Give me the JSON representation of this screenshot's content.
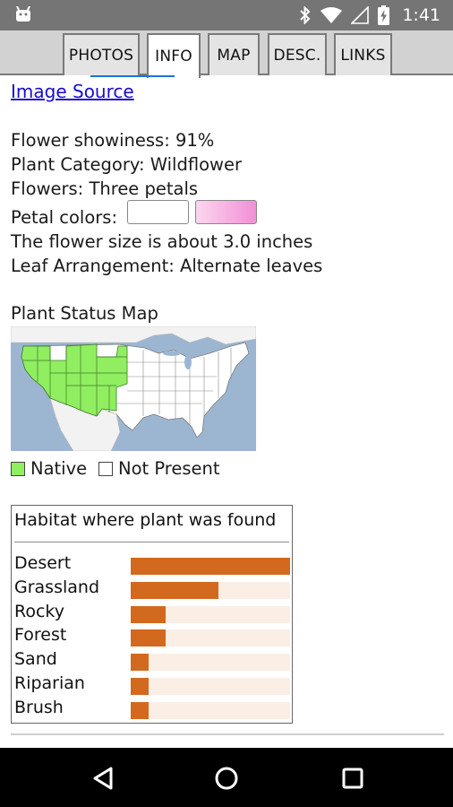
{
  "status_bar": {
    "time": "1:41",
    "icons": [
      "android-icon",
      "bluetooth-icon",
      "wifi-icon",
      "signal-icon",
      "battery-charging-icon"
    ]
  },
  "tabs": [
    {
      "label": "PHOTOS",
      "active": false
    },
    {
      "label": "INFO",
      "active": true
    },
    {
      "label": "MAP",
      "active": false
    },
    {
      "label": "DESC.",
      "active": false
    },
    {
      "label": "LINKS",
      "active": false
    }
  ],
  "info": {
    "image_source_link": "Image Source",
    "showiness": "Flower showiness: 91%",
    "category": "Plant Category: Wildflower",
    "flowers": "Flowers: Three petals",
    "petal_colors_label": "Petal colors:",
    "petal_colors": [
      "#ffffff",
      "#f4a6dc"
    ],
    "flower_size": "The flower size is about 3.0 inches",
    "leaf_arrangement": "Leaf Arrangement: Alternate leaves"
  },
  "status_map": {
    "title": "Plant Status Map",
    "legend": [
      {
        "label": "Native",
        "color": "#90ee60"
      },
      {
        "label": "Not Present",
        "color": "#ffffff"
      }
    ]
  },
  "habitat": {
    "title": "Habitat where plant was found",
    "accent_color": "#d2691e",
    "track_color": "#fbeee4",
    "items": [
      {
        "label": "Desert",
        "fraction": 1.0
      },
      {
        "label": "Grassland",
        "fraction": 0.55
      },
      {
        "label": "Rocky",
        "fraction": 0.22
      },
      {
        "label": "Forest",
        "fraction": 0.22
      },
      {
        "label": "Sand",
        "fraction": 0.11
      },
      {
        "label": "Riparian",
        "fraction": 0.11
      },
      {
        "label": "Brush",
        "fraction": 0.11
      }
    ]
  },
  "nav_bar": {
    "buttons": [
      "back-icon",
      "home-icon",
      "recents-icon"
    ]
  }
}
